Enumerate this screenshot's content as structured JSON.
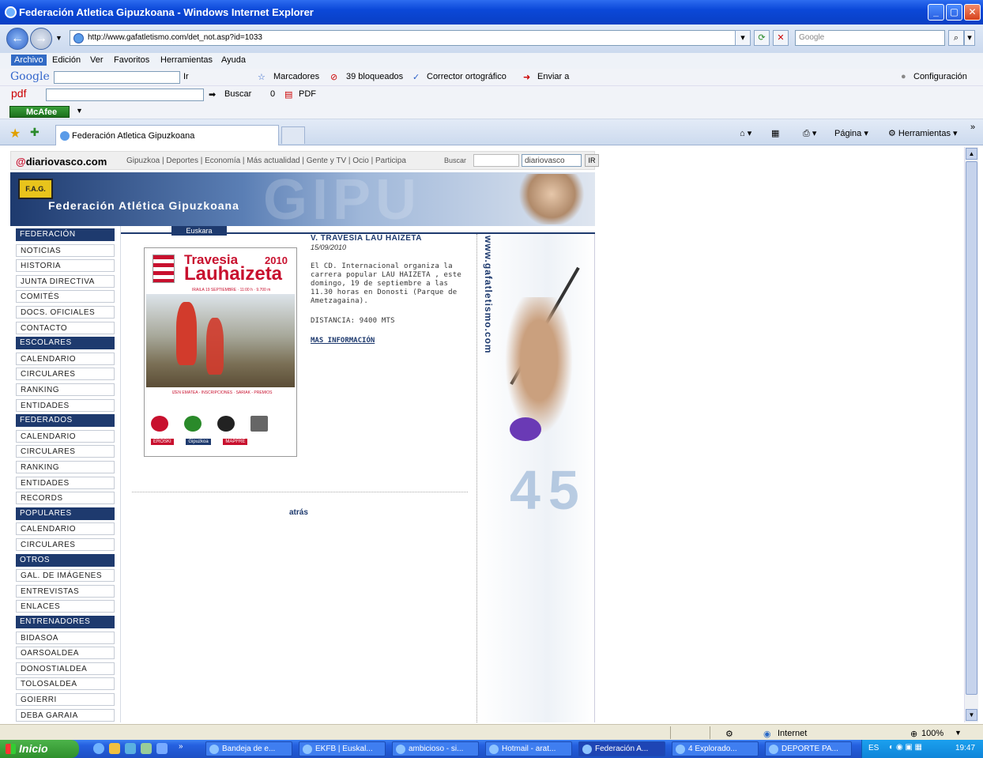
{
  "window": {
    "title": "Federación Atletica Gipuzkoana - Windows Internet Explorer"
  },
  "address": {
    "url": "http://www.gafatletismo.com/det_not.asp?id=1033",
    "search_placeholder": "Google"
  },
  "menu": [
    "Archivo",
    "Edición",
    "Ver",
    "Favoritos",
    "Herramientas",
    "Ayuda"
  ],
  "google_toolbar": {
    "logo": "Google",
    "go": "Ir",
    "bookmarks": "Marcadores",
    "blocked": "39 bloqueados",
    "spell": "Corrector ortográfico",
    "send": "Enviar a",
    "settings": "Configuración"
  },
  "pdf_toolbar": {
    "logo": "pdf",
    "search": "Buscar",
    "count": "0",
    "pdf": "PDF"
  },
  "mcafee": "McAfee",
  "tabs": {
    "active": "Federación Atletica Gipuzkoana",
    "page": "Página",
    "tools": "Herramientas"
  },
  "site": {
    "dv_logo_at": "@",
    "dv_logo": "diariovasco.com",
    "dv_links": "Gipuzkoa | Deportes | Economía | Más actualidad | Gente y TV | Ocio | Participa",
    "dv_search": "Buscar",
    "dv_select": "diariovasco",
    "dv_go": "IR",
    "banner_badge": "F.A.G.",
    "banner_name": "Federación Atlética Gipuzkoana",
    "banner_watermark": "GIPU",
    "euskara": "Euskara"
  },
  "nav": [
    {
      "label": "FEDERACIÓN",
      "type": "h"
    },
    {
      "label": "NOTICIAS",
      "type": "l"
    },
    {
      "label": "HISTORIA",
      "type": "l"
    },
    {
      "label": "JUNTA DIRECTIVA",
      "type": "l"
    },
    {
      "label": "COMITÉS",
      "type": "l"
    },
    {
      "label": "DOCS. OFICIALES",
      "type": "l"
    },
    {
      "label": "CONTACTO",
      "type": "l"
    },
    {
      "label": "ESCOLARES",
      "type": "h"
    },
    {
      "label": "CALENDARIO",
      "type": "l"
    },
    {
      "label": "CIRCULARES",
      "type": "l"
    },
    {
      "label": "RANKING",
      "type": "l"
    },
    {
      "label": "ENTIDADES",
      "type": "l"
    },
    {
      "label": "FEDERADOS",
      "type": "h"
    },
    {
      "label": "CALENDARIO",
      "type": "l"
    },
    {
      "label": "CIRCULARES",
      "type": "l"
    },
    {
      "label": "RANKING",
      "type": "l"
    },
    {
      "label": "ENTIDADES",
      "type": "l"
    },
    {
      "label": "RECORDS",
      "type": "l"
    },
    {
      "label": "POPULARES",
      "type": "h"
    },
    {
      "label": "CALENDARIO",
      "type": "l"
    },
    {
      "label": "CIRCULARES",
      "type": "l"
    },
    {
      "label": "OTROS",
      "type": "h"
    },
    {
      "label": "GAL. DE IMÁGENES",
      "type": "l"
    },
    {
      "label": "ENTREVISTAS",
      "type": "l"
    },
    {
      "label": "ENLACES",
      "type": "l"
    },
    {
      "label": "ENTRENADORES",
      "type": "h"
    },
    {
      "label": "BIDASOA",
      "type": "l"
    },
    {
      "label": "OARSOALDEA",
      "type": "l"
    },
    {
      "label": "DONOSTIALDEA",
      "type": "l"
    },
    {
      "label": "TOLOSALDEA",
      "type": "l"
    },
    {
      "label": "GOIERRI",
      "type": "l"
    },
    {
      "label": "DEBA GARAIA",
      "type": "l"
    }
  ],
  "poster": {
    "title1": "Travesia",
    "year": "2010",
    "title2": "Lauhaizeta",
    "sub": "IRAILA 19 SEPTIEMBRE · 11:00 h · 9.700 m",
    "info": "IZEN EMATEA - INSCRIPCIONES · SARIAK - PREMIOS",
    "sponsor1": "EROSKI",
    "sponsor2": "Gipuzkoa",
    "sponsor3": "MAPFRE"
  },
  "article": {
    "title": "V. TRAVESIA LAU HAIZETA",
    "date": "15/09/2010",
    "body": "El CD. Internacional organiza la carrera popular LAU HAIZETA , este domingo, 19 de septiembre a las 11.30 horas en Donosti (Parque de Ametzagaina).",
    "distance": "DISTANCIA: 9400 MTS",
    "more": "MAS INFORMACIÓN",
    "back": "atrás"
  },
  "rightcol": {
    "url": "www.gafatletismo.com",
    "num": "45"
  },
  "status": {
    "zone": "Internet",
    "zoom": "100%"
  },
  "taskbar": {
    "start": "Inicio",
    "items": [
      "Bandeja de e...",
      "EKFB | Euskal...",
      "ambicioso - si...",
      "Hotmail - arat...",
      "Federación A...",
      "4 Explorado...",
      "DEPORTE PA..."
    ],
    "lang": "ES",
    "clock": "19:47"
  }
}
